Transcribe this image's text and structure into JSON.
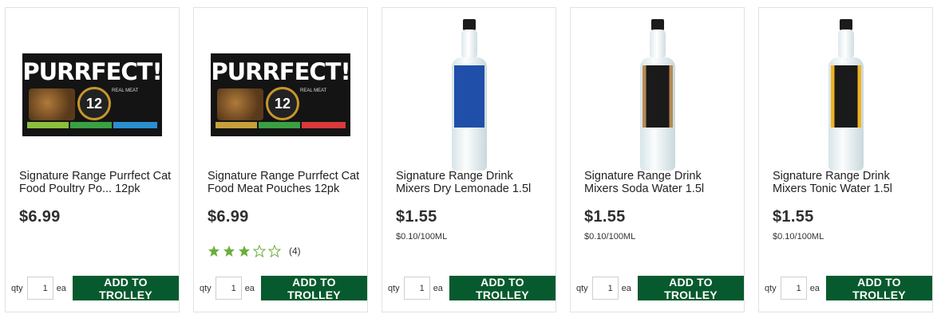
{
  "products": [
    {
      "title": "Signature Range Purrfect Cat Food Poultry Po... 12pk",
      "price": "$6.99",
      "unit_price": "",
      "image_brand": "PURRFECT!",
      "image_badge": "12",
      "image_text": "REAL MEAT",
      "qty_label": "qty",
      "qty_value": "1",
      "ea_label": "ea",
      "button_label": "ADD TO TROLLEY"
    },
    {
      "title": "Signature Range Purrfect Cat Food Meat Pouches 12pk",
      "price": "$6.99",
      "unit_price": "",
      "image_brand": "PURRFECT!",
      "image_badge": "12",
      "image_text": "REAL MEAT",
      "rating": 3,
      "rating_max": 5,
      "rating_count": "(4)",
      "qty_label": "qty",
      "qty_value": "1",
      "ea_label": "ea",
      "button_label": "ADD TO TROLLEY"
    },
    {
      "title": "Signature Range Drink Mixers Dry Lemonade 1.5l",
      "price": "$1.55",
      "unit_price": "$0.10/100ML",
      "label_color": "#1f4fa8",
      "qty_label": "qty",
      "qty_value": "1",
      "ea_label": "ea",
      "button_label": "ADD TO TROLLEY"
    },
    {
      "title": "Signature Range Drink Mixers Soda Water 1.5l",
      "price": "$1.55",
      "unit_price": "$0.10/100ML",
      "label_color": "#b88a52",
      "qty_label": "qty",
      "qty_value": "1",
      "ea_label": "ea",
      "button_label": "ADD TO TROLLEY"
    },
    {
      "title": "Signature Range Drink Mixers Tonic Water 1.5l",
      "price": "$1.55",
      "unit_price": "$0.10/100ML",
      "label_color": "#f0b323",
      "qty_label": "qty",
      "qty_value": "1",
      "ea_label": "ea",
      "button_label": "ADD TO TROLLEY"
    }
  ],
  "colors": {
    "button_bg": "#075a2e",
    "star": "#6aae3a",
    "card_border": "#e2e2e2"
  }
}
